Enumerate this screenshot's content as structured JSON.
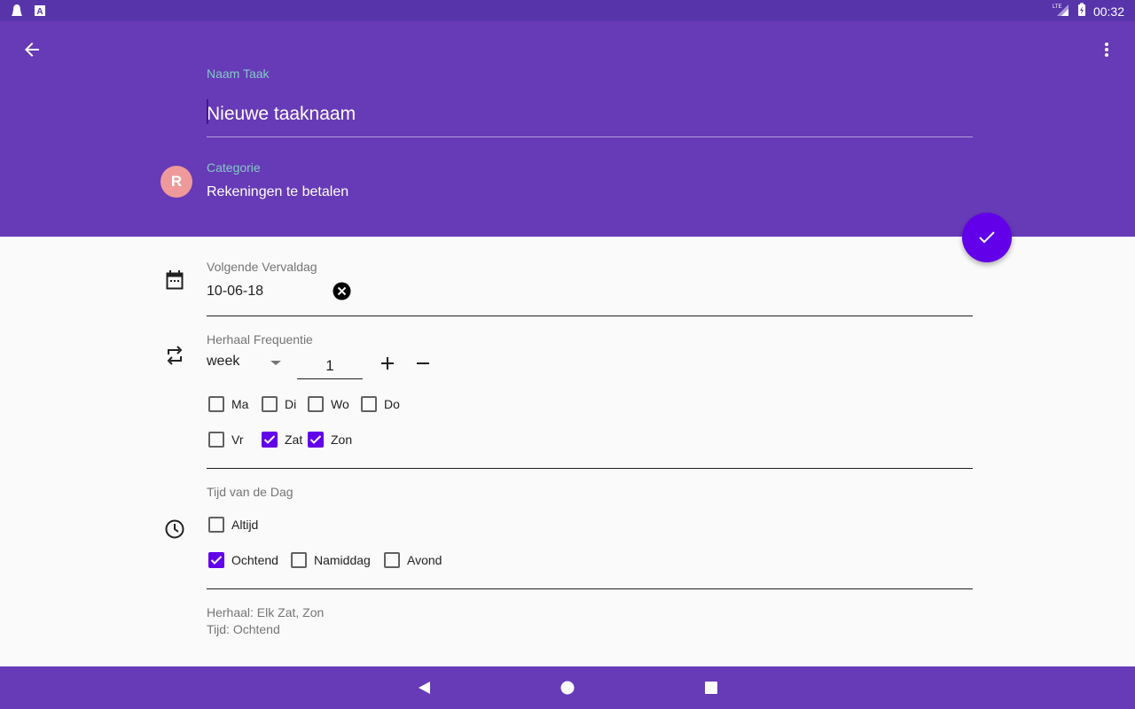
{
  "status_bar": {
    "network": "LTE",
    "time": "00:32"
  },
  "app_bar": {
    "name_label": "Naam Taak",
    "name_placeholder": "Nieuwe taaknaam",
    "category_label": "Categorie",
    "category_value": "Rekeningen te betalen",
    "category_initial": "R",
    "category_color": "#ef9a9a"
  },
  "due": {
    "label": "Volgende Vervaldag",
    "value": "10-06-18"
  },
  "frequency": {
    "label": "Herhaal Frequentie",
    "unit": "week",
    "count": "1"
  },
  "days": [
    {
      "label": "Ma",
      "checked": false
    },
    {
      "label": "Di",
      "checked": false
    },
    {
      "label": "Wo",
      "checked": false
    },
    {
      "label": "Do",
      "checked": false
    },
    {
      "label": "Vr",
      "checked": false
    },
    {
      "label": "Zat",
      "checked": true
    },
    {
      "label": "Zon",
      "checked": true
    }
  ],
  "time_of_day": {
    "label": "Tijd van de Dag",
    "options": [
      {
        "label": "Altijd",
        "checked": false
      },
      {
        "label": "Ochtend",
        "checked": true
      },
      {
        "label": "Namiddag",
        "checked": false
      },
      {
        "label": "Avond",
        "checked": false
      }
    ]
  },
  "summary": {
    "repeat": "Herhaal: Elk Zat, Zon",
    "time": "Tijd: Ochtend"
  },
  "colors": {
    "primary": "#673ab7",
    "accent": "#6200ea",
    "status_bar": "#5834ab"
  }
}
